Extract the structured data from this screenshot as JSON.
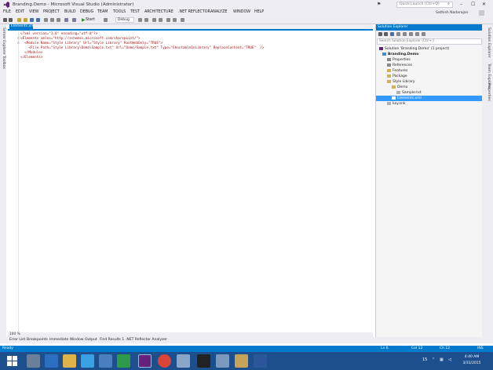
{
  "window": {
    "title": "Branding.Demo - Microsoft Visual Studio (Administrator)",
    "quick_launch_placeholder": "Quick Launch (Ctrl+Q)"
  },
  "menu": [
    "FILE",
    "EDIT",
    "VIEW",
    "PROJECT",
    "BUILD",
    "DEBUG",
    "TEAM",
    "TOOLS",
    "TEST",
    "ARCHITECTURE",
    ".NET REFLECTOR",
    "ANALYZE",
    "WINDOW",
    "HELP"
  ],
  "user": "Sathish Nadarajan",
  "toolbar": {
    "start_label": "Start",
    "config": "Debug"
  },
  "left_tabs": [
    "Server Explorer",
    "Toolbox"
  ],
  "editor": {
    "tab_label": "Elements.xml",
    "zoom": "100 %",
    "lines": [
      "<?xml version=\"1.0\" encoding=\"utf-8\"?>",
      "<Elements xmlns=\"http://schemas.microsoft.com/sharepoint/\">",
      "  <Module Name=\"Style Library\" Url=\"Style Library\" RootWebOnly=\"TRUE\">",
      "    <File Path=\"Style Library\\Demo\\Sample.txt\" Url=\"Demo/Sample.txt\" Type=\"GhostableInLibrary\" ReplaceContent=\"TRUE\"  />",
      "  </Module>",
      "</Elements>"
    ]
  },
  "solution_explorer": {
    "title": "Solution Explorer",
    "search_placeholder": "Search Solution Explorer (Ctrl+;)",
    "items": [
      {
        "label": "Solution 'Branding.Demo' (1 project)"
      },
      {
        "label": "Branding.Demo"
      },
      {
        "label": "Properties"
      },
      {
        "label": "References"
      },
      {
        "label": "Features"
      },
      {
        "label": "Package"
      },
      {
        "label": "Style Library"
      },
      {
        "label": "Demo"
      },
      {
        "label": "Sample.txt"
      },
      {
        "label": "Elements.xml"
      },
      {
        "label": "key.snk"
      }
    ]
  },
  "right_tabs": [
    "Solution Explorer",
    "Team Explorer",
    "Properties"
  ],
  "bottom_tabs": [
    "Error List",
    "Breakpoints",
    "Immediate Window",
    "Output",
    "Find Results 1",
    ".NET Reflector Analyzer"
  ],
  "status": {
    "ready": "Ready",
    "ln": "Ln 6",
    "col": "Col 12",
    "ch": "Ch 12",
    "mode": "INS"
  },
  "taskbar": {
    "time": "4:40 AM",
    "date": "3/31/2015",
    "temp": "15"
  },
  "colors": {
    "accent": "#007acc",
    "chrome": "#eeeef2",
    "taskbar": "#1d4f8c",
    "selection": "#3399ff"
  }
}
